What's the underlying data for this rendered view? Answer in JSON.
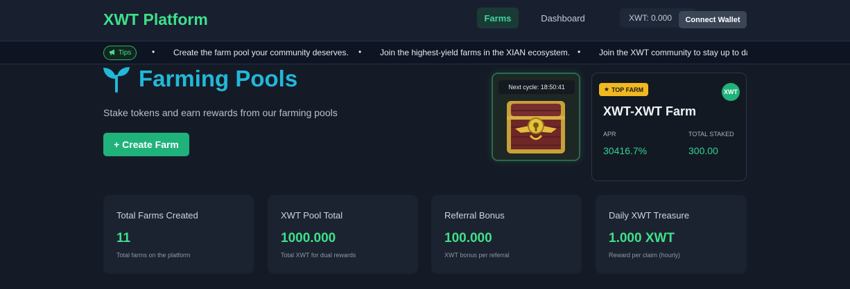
{
  "header": {
    "brand": "XWT Platform",
    "nav": {
      "farms": "Farms",
      "dashboard": "Dashboard"
    },
    "balance": "XWT: 0.000",
    "connect_label": "Connect Wallet"
  },
  "tips": {
    "badge": "Tips",
    "items": [
      "Create the farm pool your community deserves.",
      "Join the highest-yield farms in the XIAN ecosystem.",
      "Join the XWT community to stay up to dat"
    ]
  },
  "hero": {
    "title": "Farming Pools",
    "subtitle": "Stake tokens and earn rewards from our farming pools",
    "create_label": "+ Create Farm"
  },
  "chest": {
    "cycle": "Next cycle: 18:50:41"
  },
  "top_farm": {
    "badge": "TOP FARM",
    "token": "XWT",
    "name": "XWT-XWT Farm",
    "apr_label": "APR",
    "apr_value": "30416.7%",
    "staked_label": "TOTAL STAKED",
    "staked_value": "300.00"
  },
  "stats": [
    {
      "title": "Total Farms Created",
      "value": "11",
      "desc": "Total farms on the platform"
    },
    {
      "title": "XWT Pool Total",
      "value": "1000.000",
      "desc": "Total XWT for dual rewards"
    },
    {
      "title": "Referral Bonus",
      "value": "100.000",
      "desc": "XWT bonus per referral"
    },
    {
      "title": "Daily XWT Treasure",
      "value": "1.000 XWT",
      "desc": "Reward per claim (hourly)"
    }
  ]
}
